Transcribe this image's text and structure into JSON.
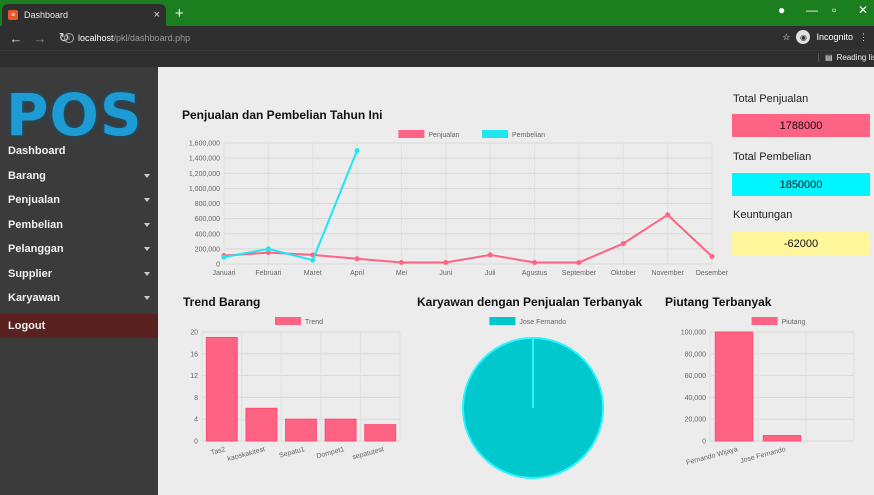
{
  "browser": {
    "tab_title": "Dashboard",
    "tab_close": "×",
    "new_tab": "+",
    "url_host": "localhost",
    "url_path": "/pkl/dashboard.php",
    "incognito": "Incognito",
    "reading_list": "Reading lis"
  },
  "sidebar": {
    "logo": "POS",
    "items": [
      {
        "label": "Dashboard",
        "caret": false
      },
      {
        "label": "Barang",
        "caret": true
      },
      {
        "label": "Penjualan",
        "caret": true
      },
      {
        "label": "Pembelian",
        "caret": true
      },
      {
        "label": "Pelanggan",
        "caret": true
      },
      {
        "label": "Supplier",
        "caret": true
      },
      {
        "label": "Karyawan",
        "caret": true
      }
    ],
    "logout": "Logout"
  },
  "stats": {
    "total_penjualan_label": "Total Penjualan",
    "total_penjualan_value": "1788000",
    "total_pembelian_label": "Total Pembelian",
    "total_pembelian_value": "1850000",
    "keuntungan_label": "Keuntungan",
    "keuntungan_value": "-62000",
    "colors": {
      "penjualan": "#ff6384",
      "pembelian": "#00f5ff",
      "keuntungan": "#fff59a"
    }
  },
  "chart_data": [
    {
      "type": "line",
      "title": "Penjualan dan Pembelian Tahun Ini",
      "categories": [
        "Januari",
        "Februari",
        "Maret",
        "April",
        "Mei",
        "Juni",
        "Juli",
        "Agustus",
        "September",
        "Oktober",
        "November",
        "Desember"
      ],
      "series": [
        {
          "name": "Penjualan",
          "color": "#ff6384",
          "values": [
            110000,
            150000,
            120000,
            70000,
            20000,
            20000,
            120000,
            20000,
            20000,
            270000,
            650000,
            100000
          ]
        },
        {
          "name": "Pembelian",
          "color": "#22e5f0",
          "values": [
            90000,
            200000,
            50000,
            1500000
          ]
        }
      ],
      "yticks": [
        0,
        200000,
        400000,
        600000,
        800000,
        1000000,
        1200000,
        1400000,
        1600000
      ],
      "ytick_labels": [
        "0",
        "200,000",
        "400,000",
        "600,000",
        "800,000",
        "1,000,000",
        "1,200,000",
        "1,400,000",
        "1,600,000"
      ],
      "ylim": [
        0,
        1600000
      ],
      "legend": "top"
    },
    {
      "type": "bar",
      "title": "Trend Barang",
      "categories": [
        "Tas2",
        "kaoskakitest",
        "Sepatu1",
        "Dompet1",
        "sepatutest"
      ],
      "series": [
        {
          "name": "Trend",
          "color": "#ff6384",
          "values": [
            19,
            6,
            4,
            4,
            3
          ]
        }
      ],
      "yticks": [
        0,
        4,
        8,
        12,
        16,
        20
      ],
      "ytick_labels": [
        "0",
        "4",
        "8",
        "12",
        "16",
        "20"
      ],
      "ylim": [
        0,
        20
      ],
      "legend": "top"
    },
    {
      "type": "pie",
      "title": "Karyawan dengan Penjualan Terbanyak",
      "categories": [
        "Jose Fernando"
      ],
      "values": [
        100
      ],
      "colors": [
        "#00c8cc"
      ],
      "legend": "top"
    },
    {
      "type": "bar",
      "title": "Piutang Terbanyak",
      "categories": [
        "Fernando Wijaya",
        "Jose Fernando",
        ""
      ],
      "series": [
        {
          "name": "Piutang",
          "color": "#ff6384",
          "values": [
            100000,
            5000,
            0
          ]
        }
      ],
      "yticks": [
        0,
        20000,
        40000,
        60000,
        80000,
        100000
      ],
      "ytick_labels": [
        "0",
        "20,000",
        "40,000",
        "60,000",
        "80,000",
        "100,000"
      ],
      "ylim": [
        0,
        100000
      ],
      "legend": "top"
    }
  ]
}
